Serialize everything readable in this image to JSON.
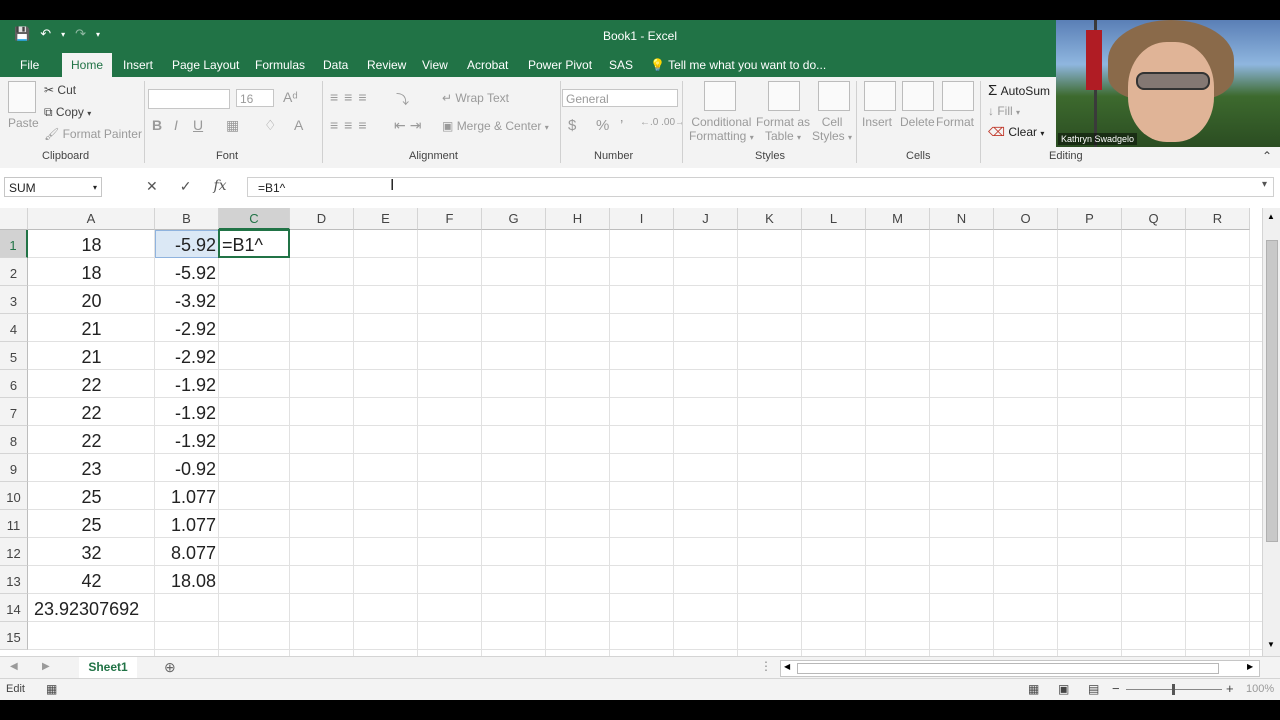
{
  "window": {
    "title": "Book1 - Excel"
  },
  "qat": {
    "save_icon": "save-icon",
    "undo_icon": "undo-icon",
    "redo_icon": "redo-icon",
    "customize_icon": "customize-qat-icon"
  },
  "tabs": [
    {
      "label": "File"
    },
    {
      "label": "Home"
    },
    {
      "label": "Insert"
    },
    {
      "label": "Page Layout"
    },
    {
      "label": "Formulas"
    },
    {
      "label": "Data"
    },
    {
      "label": "Review"
    },
    {
      "label": "View"
    },
    {
      "label": "Acrobat"
    },
    {
      "label": "Power Pivot"
    },
    {
      "label": "SAS"
    }
  ],
  "tell_me": "Tell me what you want to do...",
  "ribbon": {
    "clipboard": {
      "paste": "Paste",
      "cut": "Cut",
      "copy": "Copy",
      "format_painter": "Format Painter",
      "label": "Clipboard"
    },
    "font": {
      "size": "16",
      "bold": "B",
      "italic": "I",
      "underline": "U",
      "label": "Font"
    },
    "alignment": {
      "wrap_text": "Wrap Text",
      "merge_center": "Merge & Center",
      "label": "Alignment"
    },
    "number": {
      "format": "General",
      "currency": "$",
      "percent": "%",
      "comma": "’",
      "label": "Number"
    },
    "styles": {
      "conditional_1": "Conditional",
      "conditional_2": "Formatting",
      "format_table_1": "Format as",
      "format_table_2": "Table",
      "cell_styles_1": "Cell",
      "cell_styles_2": "Styles",
      "label": "Styles"
    },
    "cells": {
      "insert": "Insert",
      "delete": "Delete",
      "format": "Format",
      "label": "Cells"
    },
    "editing": {
      "autosum": "AutoSum",
      "fill": "Fill",
      "clear": "Clear",
      "label": "Editing"
    }
  },
  "formula_bar": {
    "name_box": "SUM",
    "formula": "=B1^"
  },
  "columns": [
    "A",
    "B",
    "C",
    "D",
    "E",
    "F",
    "G",
    "H",
    "I",
    "J",
    "K",
    "L",
    "M",
    "N",
    "O",
    "P",
    "Q",
    "R"
  ],
  "rows": [
    "1",
    "2",
    "3",
    "4",
    "5",
    "6",
    "7",
    "8",
    "9",
    "10",
    "11",
    "12",
    "13",
    "14",
    "15"
  ],
  "cells": {
    "A": [
      "18",
      "18",
      "20",
      "21",
      "21",
      "22",
      "22",
      "22",
      "23",
      "25",
      "25",
      "32",
      "42",
      "23.92307692",
      ""
    ],
    "B": [
      "-5.92",
      "-5.92",
      "-3.92",
      "-2.92",
      "-2.92",
      "-1.92",
      "-1.92",
      "-1.92",
      "-0.92",
      "1.077",
      "1.077",
      "8.077",
      "18.08",
      "",
      ""
    ],
    "C1": "=B1^"
  },
  "sheets": [
    {
      "label": "Sheet1"
    }
  ],
  "status": {
    "mode": "Edit",
    "zoom": "100%"
  },
  "webcam": {
    "name": "Kathryn Swadgelo"
  },
  "colors": {
    "accent": "#217346"
  }
}
